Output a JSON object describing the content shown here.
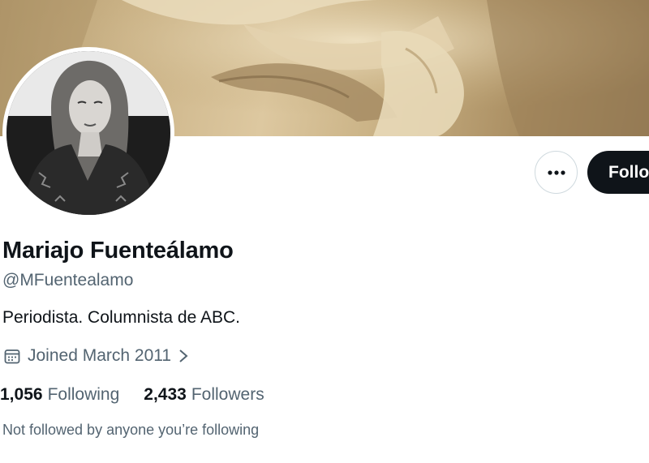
{
  "profile": {
    "name": "Mariajo Fuenteálamo",
    "handle": "@MFuentealamo",
    "bio": "Periodista. Columnista de ABC.",
    "joined": "Joined March 2011",
    "following_count": "1,056",
    "following_label": "Following",
    "followers_count": "2,433",
    "followers_label": "Followers",
    "not_followed_note": "Not followed by anyone you’re following"
  },
  "actions": {
    "follow_label": "Follo",
    "more_icon": "more-horizontal-icon"
  },
  "icons": {
    "calendar": "calendar-icon",
    "chevron": "chevron-right-icon"
  },
  "colors": {
    "text_primary": "#0f1419",
    "text_secondary": "#536471",
    "follow_bg": "#0f1419",
    "border": "#cfd9de"
  }
}
